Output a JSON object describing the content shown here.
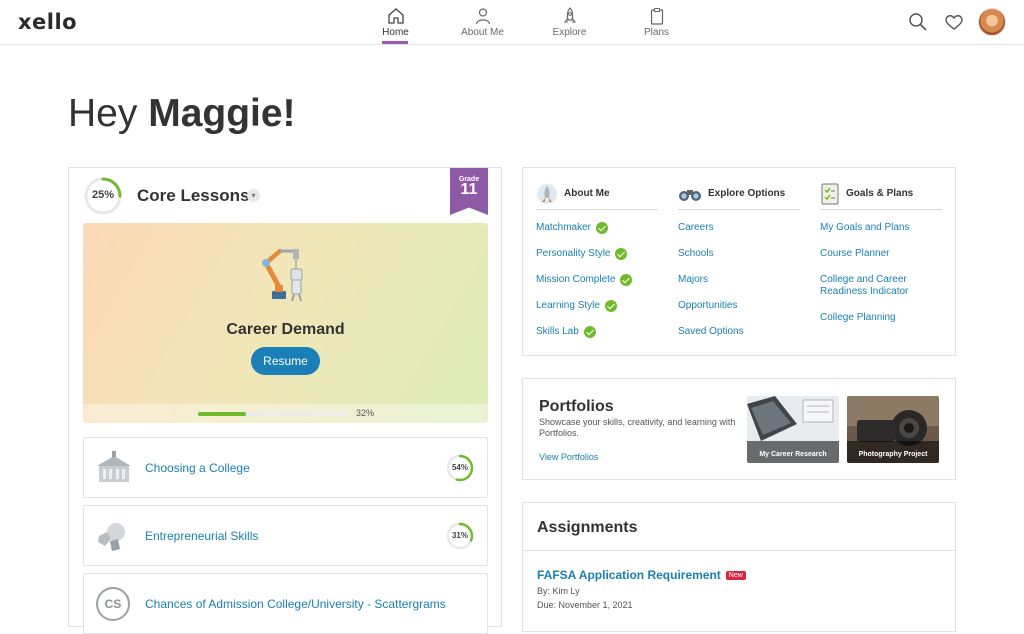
{
  "brand": {
    "name": "xello"
  },
  "nav": {
    "items": [
      {
        "label": "Home",
        "icon": "home-icon",
        "active": true
      },
      {
        "label": "About Me",
        "icon": "person-icon",
        "active": false
      },
      {
        "label": "Explore",
        "icon": "rocket-icon",
        "active": false
      },
      {
        "label": "Plans",
        "icon": "clipboard-icon",
        "active": false
      }
    ],
    "right_icons": [
      "search-icon",
      "heart-icon",
      "avatar"
    ]
  },
  "greeting": {
    "prefix": "Hey",
    "name": "Maggie!"
  },
  "core": {
    "percent": "25%",
    "percent_value": 0.25,
    "title": "Core Lessons",
    "grade_label": "Grade",
    "grade": "11",
    "current_lesson": {
      "title": "Career Demand",
      "button": "Resume",
      "progress_label": "32%",
      "progress_value": 0.32
    },
    "lessons": [
      {
        "title": "Choosing a College",
        "percent": "54%",
        "value": 0.54,
        "icon": "college-building-icon"
      },
      {
        "title": "Entrepreneurial Skills",
        "percent": "31%",
        "value": 0.31,
        "icon": "puzzle-icon"
      },
      {
        "title": "Chances of Admission College/University - Scattergrams",
        "initials": "CS",
        "icon": "cs-initials-icon"
      }
    ]
  },
  "quick_links": {
    "columns": [
      {
        "title": "About Me",
        "icon": "rocket-icon",
        "links": [
          {
            "label": "Matchmaker",
            "done": true
          },
          {
            "label": "Personality Style",
            "done": true
          },
          {
            "label": "Mission Complete",
            "done": true
          },
          {
            "label": "Learning Style",
            "done": true
          },
          {
            "label": "Skills Lab",
            "done": true
          }
        ]
      },
      {
        "title": "Explore Options",
        "icon": "binoculars-icon",
        "links": [
          {
            "label": "Careers"
          },
          {
            "label": "Schools"
          },
          {
            "label": "Majors"
          },
          {
            "label": "Opportunities"
          },
          {
            "label": "Saved Options"
          }
        ]
      },
      {
        "title": "Goals & Plans",
        "icon": "checklist-icon",
        "links": [
          {
            "label": "My Goals and Plans"
          },
          {
            "label": "Course Planner"
          },
          {
            "label": "College and Career Readiness Indicator"
          },
          {
            "label": "College Planning"
          }
        ]
      }
    ]
  },
  "portfolios": {
    "title": "Portfolios",
    "description": "Showcase your skills, creativity, and learning with Portfolios.",
    "link": "View Portfolios",
    "items": [
      {
        "caption": "My Career Research"
      },
      {
        "caption": "Photography Project"
      }
    ]
  },
  "assignments": {
    "title": "Assignments",
    "items": [
      {
        "title": "FAFSA Application Requirement",
        "badge": "New",
        "by": "By: Kim Ly",
        "due": "Due: November 1, 2021"
      }
    ]
  },
  "colors": {
    "accent": "#1a7fb7",
    "brand_purple": "#8e5aa6",
    "success": "#6fbb2e",
    "badge_red": "#d6283d"
  }
}
